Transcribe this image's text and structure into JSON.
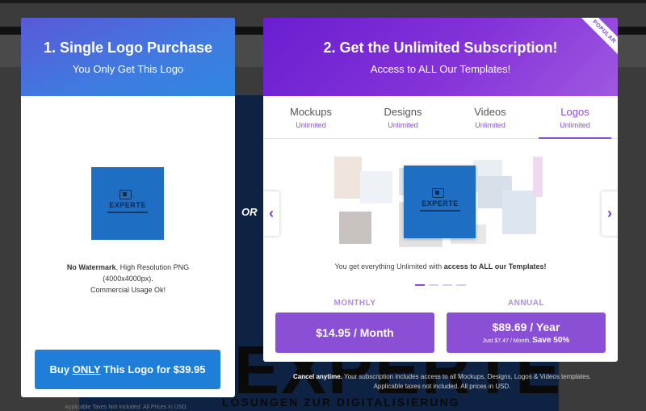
{
  "background": {
    "hero_title": "EXPERTE",
    "hero_subtitle": "LÖSUNGEN ZUR DIGITALISIERUNG",
    "footer_text": "Applicable Taxes Not Included. All Prices in USD."
  },
  "single_purchase": {
    "title": "1. Single Logo Purchase",
    "subtitle": "You Only Get This Logo",
    "logo_text": "EXPERTE",
    "desc_bold": "No Watermark",
    "desc_line1": ", High Resolution PNG",
    "desc_line2": "(4000x4000px).",
    "desc_line3": "Commercial Usage Ok!",
    "buy_prefix": "Buy ",
    "buy_emphasis": "ONLY",
    "buy_suffix": " This Logo for $39.95",
    "accent_color": "#1f7fd8"
  },
  "or_label": "OR",
  "subscription": {
    "title": "2. Get the Unlimited Subscription!",
    "subtitle": "Access to ALL Our Templates!",
    "ribbon": "POPULAR",
    "tabs": [
      {
        "name": "Mockups",
        "sub": "Unlimited"
      },
      {
        "name": "Designs",
        "sub": "Unlimited"
      },
      {
        "name": "Videos",
        "sub": "Unlimited"
      },
      {
        "name": "Logos",
        "sub": "Unlimited"
      }
    ],
    "active_tab": 3,
    "collage_logo_text": "EXPERTE",
    "desc_prefix": "You get everything Unlimited with ",
    "desc_bold": "access to ALL our Templates!",
    "monthly_label": "MONTHLY",
    "monthly_price": "$14.95 / Month",
    "annual_label": "ANNUAL",
    "annual_price": "$89.69 / Year",
    "annual_note": "Just $7.47 / Month, ",
    "annual_save": "Save 50%",
    "accent_color": "#8b4fd6"
  },
  "footer": {
    "cancel_bold": "Cancel anytime.",
    "cancel_text": " Your subscription includes access to all Mockups, Designs, Logos & Videos templates.",
    "tax_text": "Applicable taxes not included. All prices in USD."
  }
}
